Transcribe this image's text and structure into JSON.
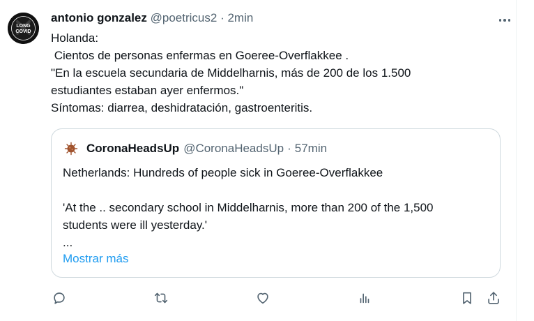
{
  "tweet": {
    "author_name": "antonio gonzalez",
    "author_handle": "@poetricus2",
    "separator": "·",
    "time": "2min",
    "avatar_text_top": "LONG",
    "avatar_text_bottom": "COVID",
    "avatar_ring_text": "LONG COVID AWARENESS",
    "text": "Holanda:\n Cientos de personas enfermas en Goeree-Overflakkee .\n\"En la escuela secundaria de Middelharnis, más de 200 de los 1.500\nestudiantes estaban ayer enfermos.\"\nSíntomas: diarrea, deshidratación, gastroenteritis."
  },
  "quote": {
    "author_name": "CoronaHeadsUp",
    "author_handle": "@CoronaHeadsUp",
    "separator": "·",
    "time": "57min",
    "text": "Netherlands: Hundreds of people sick in Goeree-Overflakkee\n\n'At the .. secondary school in Middelharnis, more than 200 of the 1,500\nstudents were ill yesterday.'\n...",
    "show_more": "Mostrar más"
  },
  "actions": [
    "reply-icon",
    "retweet-icon",
    "like-icon",
    "views-icon",
    "bookmark-icon",
    "share-icon"
  ],
  "colors": {
    "text": "#0f1419",
    "secondary": "#536471",
    "link": "#1d9bf0",
    "border": "#cfd9de",
    "virus": "#a0522d"
  }
}
